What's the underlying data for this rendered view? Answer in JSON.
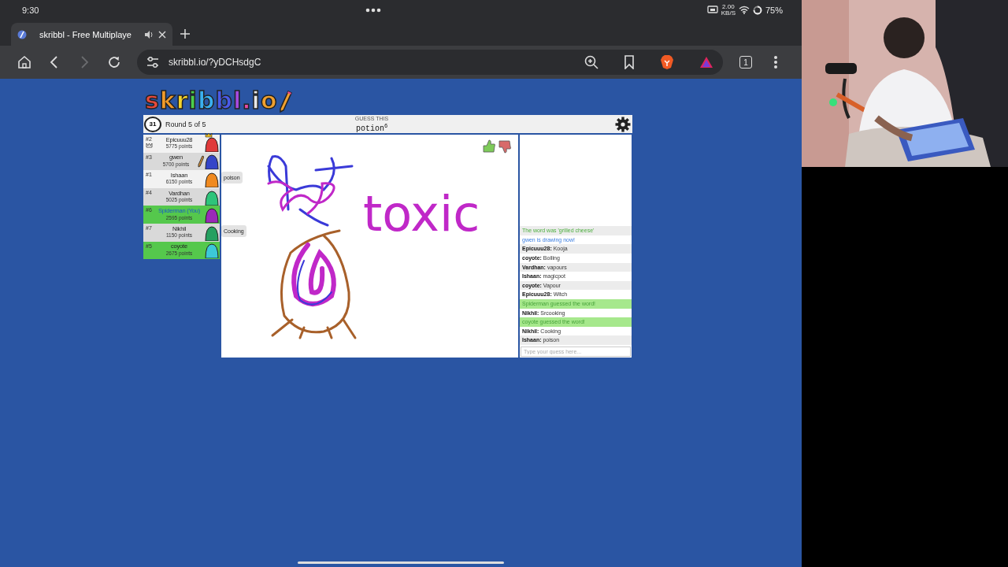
{
  "status_bar": {
    "time": "9:30",
    "net_speed": "2.00",
    "net_unit": "KB/S",
    "battery": "75%"
  },
  "browser": {
    "tabs": [
      {
        "title": "skribbl - Free Multiplaye",
        "selected": true
      }
    ],
    "url": "skribbl.io/?yDCHsdgC",
    "forward_disabled": true,
    "tab_count": "1"
  },
  "game": {
    "logo": "skribbl.io",
    "header": {
      "timer": "31",
      "round": "Round 5 of 5",
      "hint_label": "GUESS THIS",
      "word": "potion",
      "word_length": "6"
    },
    "players": [
      {
        "rank": "#2",
        "name": "Epicuuu28",
        "points": "5775 points",
        "guessed": false,
        "is_you": false,
        "drawing": false,
        "owner": true,
        "color": "#e03a3a"
      },
      {
        "rank": "#3",
        "name": "gwen",
        "points": "5700 points",
        "guessed": false,
        "is_you": false,
        "drawing": true,
        "owner": false,
        "color": "#3545c8"
      },
      {
        "rank": "#1",
        "name": "Ishaan",
        "points": "6150 points",
        "guessed": false,
        "is_you": false,
        "drawing": false,
        "owner": false,
        "color": "#f08a20",
        "bubble": "poison"
      },
      {
        "rank": "#4",
        "name": "Vardhan",
        "points": "5025 points",
        "guessed": false,
        "is_you": false,
        "drawing": false,
        "owner": false,
        "color": "#2ec47a"
      },
      {
        "rank": "#6",
        "name": "Spiderman (You)",
        "points": "2595 points",
        "guessed": true,
        "is_you": true,
        "drawing": false,
        "owner": false,
        "color": "#9a2ab8"
      },
      {
        "rank": "#7",
        "name": "Nikhil",
        "points": "1150 points",
        "guessed": false,
        "is_you": false,
        "drawing": false,
        "owner": false,
        "color": "#25a060",
        "bubble": "Cooking"
      },
      {
        "rank": "#5",
        "name": "coyote",
        "points": "2675 points",
        "guessed": true,
        "is_you": false,
        "drawing": false,
        "owner": false,
        "color": "#3cc8d8"
      }
    ],
    "canvas": {
      "scribble_text": "toxic"
    },
    "chat": {
      "messages": [
        {
          "kind": "result",
          "text": "The word was 'grilled cheese'"
        },
        {
          "kind": "info",
          "text": "gwen is drawing now!"
        },
        {
          "kind": "guess",
          "author": "Epicuuu28:",
          "text": "Kooja"
        },
        {
          "kind": "guess",
          "author": "coyote:",
          "text": "Boiling"
        },
        {
          "kind": "guess",
          "author": "Vardhan:",
          "text": "vapours"
        },
        {
          "kind": "guess",
          "author": "Ishaan:",
          "text": "magicpot"
        },
        {
          "kind": "guess",
          "author": "coyote:",
          "text": "Vapour"
        },
        {
          "kind": "guess",
          "author": "Epicuuu28:",
          "text": "Witch"
        },
        {
          "kind": "correct",
          "text": "Spiderman guessed the word!"
        },
        {
          "kind": "guess",
          "author": "Nikhil:",
          "text": "Srcooking"
        },
        {
          "kind": "correct",
          "text": "coyote guessed the word!"
        },
        {
          "kind": "guess",
          "author": "Nikhil:",
          "text": "Cooking"
        },
        {
          "kind": "guess",
          "author": "Ishaan:",
          "text": "poison"
        }
      ],
      "placeholder": "Type your guess here..."
    }
  }
}
